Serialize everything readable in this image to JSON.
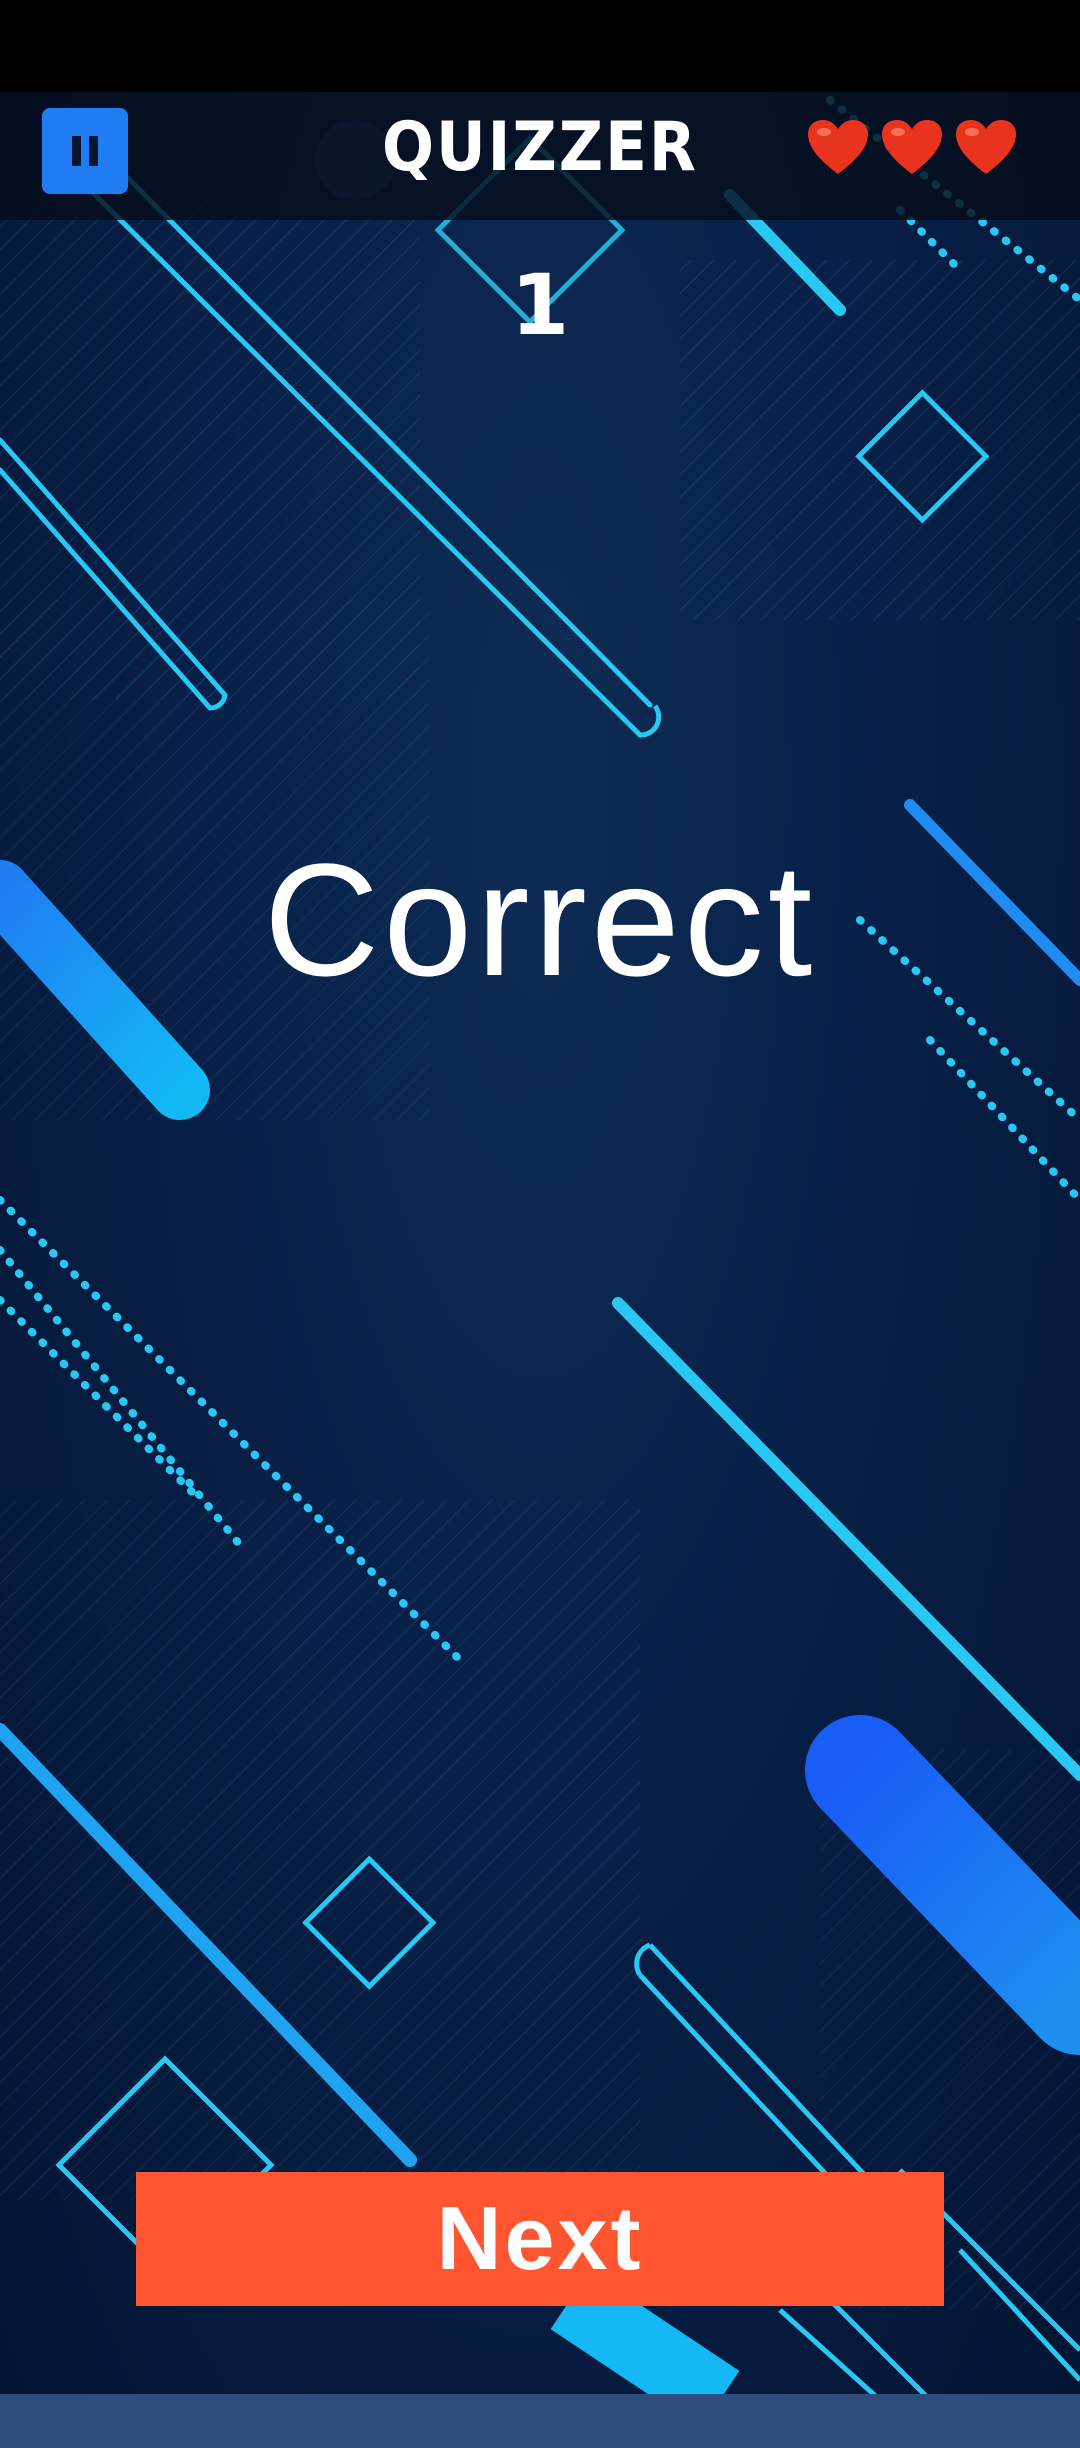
{
  "header": {
    "title": "QUIZZER",
    "pause_icon": "pause-icon",
    "lives_icon": "heart-icon",
    "lives": 3
  },
  "game": {
    "score": "1",
    "result": "Correct"
  },
  "actions": {
    "next_label": "Next"
  },
  "colors": {
    "background": "#082048",
    "accent_cyan": "#29c8f2",
    "accent_blue": "#1f7cf2",
    "next_button": "#ff5530",
    "heart": "#e8331f",
    "nav_bar": "#2f4d7c"
  }
}
